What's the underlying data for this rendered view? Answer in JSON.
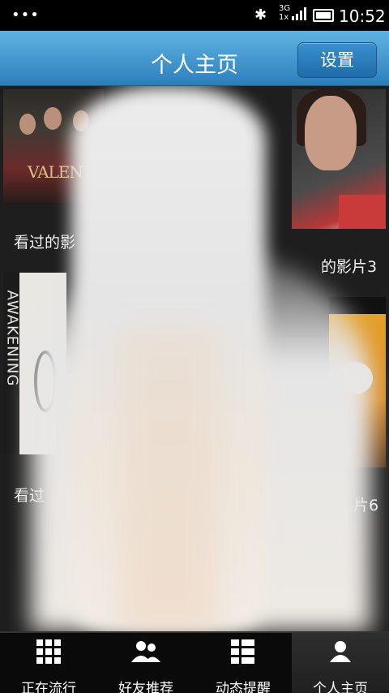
{
  "status_bar": {
    "time": "10:52",
    "network": "3G",
    "network2": "1x"
  },
  "header": {
    "title": "个人主页",
    "settings_label": "设置"
  },
  "posters": [
    {
      "label": "看过的影",
      "art_text": "VALENTINE"
    },
    {
      "label": "的影片3"
    },
    {
      "label": "看过",
      "art_text": "AWAKENING"
    },
    {
      "label": "片6"
    }
  ],
  "tabs": [
    {
      "label": "正在流行",
      "icon": "grid-icon"
    },
    {
      "label": "好友推荐",
      "icon": "friends-icon"
    },
    {
      "label": "动态提醒",
      "icon": "feed-icon"
    },
    {
      "label": "个人主页",
      "icon": "profile-icon",
      "active": true
    }
  ]
}
